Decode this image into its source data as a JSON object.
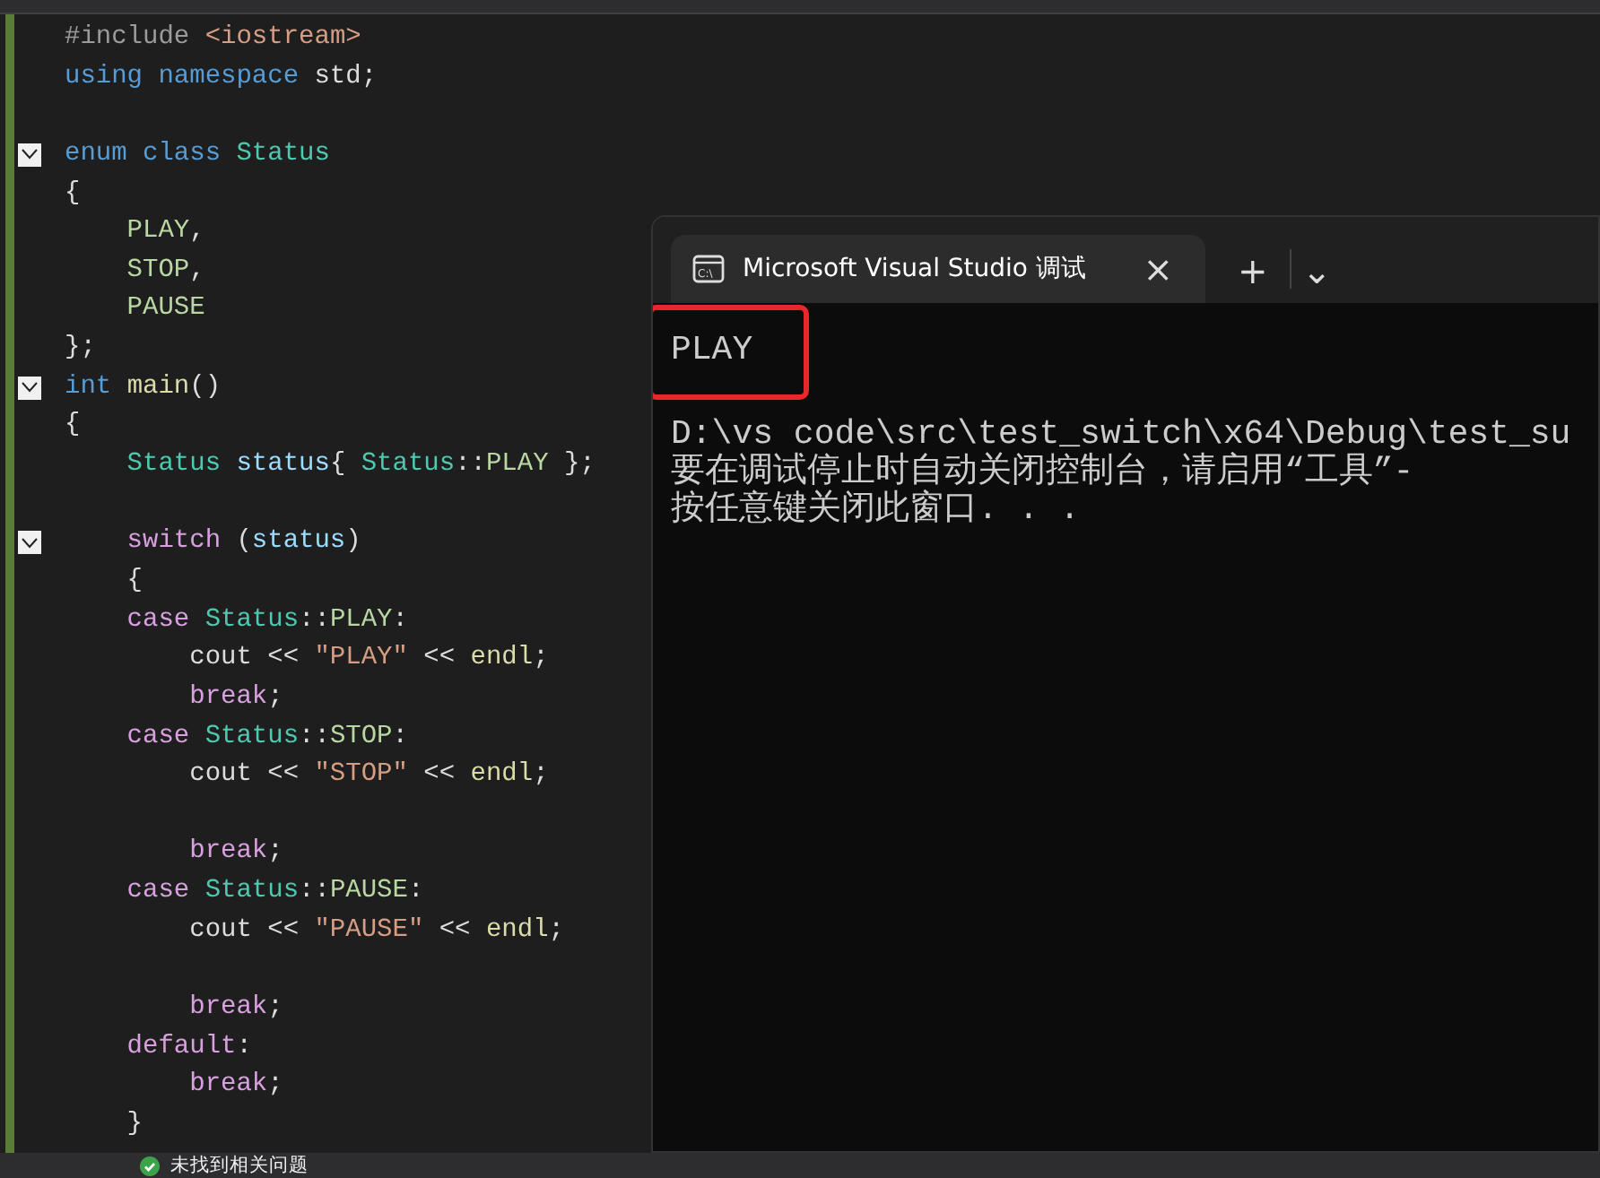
{
  "editor": {
    "lines": [
      {
        "kind": "code",
        "tokens": [
          {
            "kind": "preproc",
            "text": "#include "
          },
          {
            "kind": "string",
            "text": "<iostream>"
          }
        ]
      },
      {
        "kind": "code",
        "tokens": [
          {
            "kind": "keyword",
            "text": "using namespace "
          },
          {
            "kind": "plain",
            "text": "std;"
          }
        ]
      },
      {
        "kind": "blank"
      },
      {
        "kind": "code",
        "fold": true,
        "tokens": [
          {
            "kind": "keyword",
            "text": "enum class "
          },
          {
            "kind": "type",
            "text": "Status"
          }
        ]
      },
      {
        "kind": "code",
        "tokens": [
          {
            "kind": "plain",
            "text": "{"
          }
        ]
      },
      {
        "kind": "code",
        "tokens": [
          {
            "kind": "enum",
            "text": "    PLAY"
          },
          {
            "kind": "plain",
            "text": ","
          }
        ]
      },
      {
        "kind": "code",
        "tokens": [
          {
            "kind": "enum",
            "text": "    STOP"
          },
          {
            "kind": "plain",
            "text": ","
          }
        ]
      },
      {
        "kind": "code",
        "tokens": [
          {
            "kind": "enum",
            "text": "    PAUSE"
          }
        ]
      },
      {
        "kind": "code",
        "tokens": [
          {
            "kind": "plain",
            "text": "};"
          }
        ]
      },
      {
        "kind": "code",
        "fold": true,
        "tokens": [
          {
            "kind": "keyword",
            "text": "int "
          },
          {
            "kind": "func",
            "text": "main"
          },
          {
            "kind": "plain",
            "text": "()"
          }
        ]
      },
      {
        "kind": "code",
        "tokens": [
          {
            "kind": "plain",
            "text": "{"
          }
        ]
      },
      {
        "kind": "code",
        "tokens": [
          {
            "kind": "type",
            "text": "    Status "
          },
          {
            "kind": "variable",
            "text": "status"
          },
          {
            "kind": "plain",
            "text": "{ "
          },
          {
            "kind": "type",
            "text": "Status"
          },
          {
            "kind": "plain",
            "text": "::"
          },
          {
            "kind": "enum",
            "text": "PLAY"
          },
          {
            "kind": "plain",
            "text": " };"
          }
        ]
      },
      {
        "kind": "blank"
      },
      {
        "kind": "code",
        "fold": true,
        "tokens": [
          {
            "kind": "control",
            "text": "    switch"
          },
          {
            "kind": "plain",
            "text": " ("
          },
          {
            "kind": "variable",
            "text": "status"
          },
          {
            "kind": "plain",
            "text": ")"
          }
        ]
      },
      {
        "kind": "code",
        "tokens": [
          {
            "kind": "plain",
            "text": "    {"
          }
        ]
      },
      {
        "kind": "code",
        "tokens": [
          {
            "kind": "control",
            "text": "    case "
          },
          {
            "kind": "type",
            "text": "Status"
          },
          {
            "kind": "plain",
            "text": "::"
          },
          {
            "kind": "enum",
            "text": "PLAY"
          },
          {
            "kind": "plain",
            "text": ":"
          }
        ]
      },
      {
        "kind": "code",
        "tokens": [
          {
            "kind": "plain",
            "text": "        cout << "
          },
          {
            "kind": "string",
            "text": "\"PLAY\""
          },
          {
            "kind": "plain",
            "text": " << "
          },
          {
            "kind": "func",
            "text": "endl"
          },
          {
            "kind": "plain",
            "text": ";"
          }
        ]
      },
      {
        "kind": "code",
        "tokens": [
          {
            "kind": "control",
            "text": "        break"
          },
          {
            "kind": "plain",
            "text": ";"
          }
        ]
      },
      {
        "kind": "code",
        "tokens": [
          {
            "kind": "control",
            "text": "    case "
          },
          {
            "kind": "type",
            "text": "Status"
          },
          {
            "kind": "plain",
            "text": "::"
          },
          {
            "kind": "enum",
            "text": "STOP"
          },
          {
            "kind": "plain",
            "text": ":"
          }
        ]
      },
      {
        "kind": "code",
        "tokens": [
          {
            "kind": "plain",
            "text": "        cout << "
          },
          {
            "kind": "string",
            "text": "\"STOP\""
          },
          {
            "kind": "plain",
            "text": " << "
          },
          {
            "kind": "func",
            "text": "endl"
          },
          {
            "kind": "plain",
            "text": ";"
          }
        ]
      },
      {
        "kind": "blank"
      },
      {
        "kind": "code",
        "tokens": [
          {
            "kind": "control",
            "text": "        break"
          },
          {
            "kind": "plain",
            "text": ";"
          }
        ]
      },
      {
        "kind": "code",
        "tokens": [
          {
            "kind": "control",
            "text": "    case "
          },
          {
            "kind": "type",
            "text": "Status"
          },
          {
            "kind": "plain",
            "text": "::"
          },
          {
            "kind": "enum",
            "text": "PAUSE"
          },
          {
            "kind": "plain",
            "text": ":"
          }
        ]
      },
      {
        "kind": "code",
        "tokens": [
          {
            "kind": "plain",
            "text": "        cout << "
          },
          {
            "kind": "string",
            "text": "\"PAUSE\""
          },
          {
            "kind": "plain",
            "text": " << "
          },
          {
            "kind": "func",
            "text": "endl"
          },
          {
            "kind": "plain",
            "text": ";"
          }
        ]
      },
      {
        "kind": "blank"
      },
      {
        "kind": "code",
        "tokens": [
          {
            "kind": "control",
            "text": "        break"
          },
          {
            "kind": "plain",
            "text": ";"
          }
        ]
      },
      {
        "kind": "code",
        "tokens": [
          {
            "kind": "control",
            "text": "    default"
          },
          {
            "kind": "plain",
            "text": ":"
          }
        ]
      },
      {
        "kind": "code",
        "tokens": [
          {
            "kind": "control",
            "text": "        break"
          },
          {
            "kind": "plain",
            "text": ";"
          }
        ]
      },
      {
        "kind": "code",
        "tokens": [
          {
            "kind": "plain",
            "text": "    }"
          }
        ]
      }
    ]
  },
  "console": {
    "tab_icon_label": "C:\\",
    "tab_title": "Microsoft Visual Studio 调试",
    "tab_close": "×",
    "new_tab": "+",
    "dropdown": "⌄",
    "lines": [
      {
        "text": "PLAY",
        "highlighted": true
      },
      {
        "text": "D:\\vs code\\src\\test_switch\\x64\\Debug\\test_su",
        "highlighted": false
      },
      {
        "text": "要在调试停止时自动关闭控制台，请启用“工具”-",
        "highlighted": false
      },
      {
        "text": "按任意键关闭此窗口. . .",
        "highlighted": false
      }
    ]
  },
  "status_bar": {
    "issues": "未找到相关问题"
  }
}
